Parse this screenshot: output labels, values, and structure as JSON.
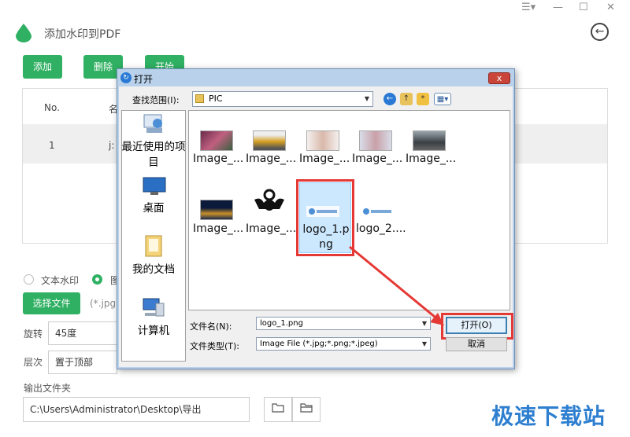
{
  "app": {
    "title": "添加水印到PDF",
    "window_controls": [
      "☰▾",
      "—",
      "☐",
      "✕"
    ],
    "back_glyph": "←",
    "buttons": {
      "add": "添加",
      "delete": "删除",
      "start": "开始"
    },
    "table": {
      "col_no": "No.",
      "col_name": "名",
      "row_no": "1",
      "row_name": "j:"
    },
    "watermark_type": {
      "text": "文本水印",
      "image": "图"
    },
    "choose_file_label": "选择文件",
    "file_hint": "(*.jpg",
    "rotate": {
      "label": "旋转",
      "value": "45度"
    },
    "layer": {
      "label": "层次",
      "value": "置于顶部"
    },
    "output": {
      "label": "输出文件夹",
      "path": "C:\\Users\\Administrator\\Desktop\\导出"
    }
  },
  "dialog": {
    "title": "打开",
    "close_glyph": "x",
    "look_in_label": "查找范围(I):",
    "look_in_value": "PIC",
    "places": [
      "最近使用的项目",
      "桌面",
      "我的文档",
      "计算机"
    ],
    "files": [
      "Image_...",
      "Image_...",
      "Image_...",
      "Image_...",
      "Image_...",
      "Image_...",
      "Image_...",
      "logo_1.png",
      "logo_2...."
    ],
    "filename_label": "文件名(N):",
    "filename_value": "logo_1.png",
    "filetype_label": "文件类型(T):",
    "filetype_value": "Image File (*.jpg;*.png;*.jpeg)",
    "open_label": "打开(O)",
    "cancel_label": "取消"
  },
  "watermark": "极速下载站",
  "colors": {
    "accent": "#2fb062",
    "highlight": "#e53935",
    "dialog_frame": "#b9d1ea"
  }
}
